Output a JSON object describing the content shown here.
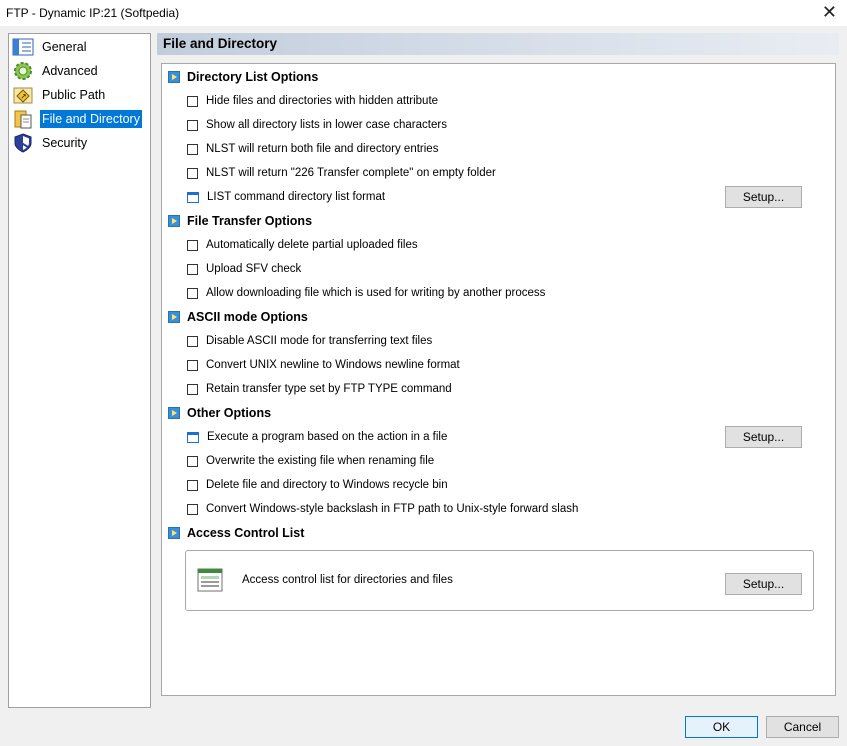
{
  "window": {
    "title": "FTP - Dynamic IP:21 (Softpedia)",
    "close_glyph": "✕"
  },
  "nav": {
    "items": [
      {
        "label": "General",
        "icon": "general-icon",
        "selected": false
      },
      {
        "label": "Advanced",
        "icon": "gear-icon",
        "selected": false
      },
      {
        "label": "Public Path",
        "icon": "public-path-icon",
        "selected": false
      },
      {
        "label": "File and Directory",
        "icon": "file-directory-icon",
        "selected": true
      },
      {
        "label": "Security",
        "icon": "shield-icon",
        "selected": false
      }
    ]
  },
  "page_title": "File and Directory",
  "sections": {
    "directory_list": {
      "title": "Directory List Options",
      "options": [
        "Hide files and directories with hidden attribute",
        "Show all directory lists in lower case characters",
        "NLST will return both file and directory entries",
        "NLST will return \"226 Transfer complete\" on empty folder",
        "LIST command directory list format"
      ]
    },
    "file_transfer": {
      "title": "File Transfer Options",
      "options": [
        "Automatically delete partial uploaded files",
        "Upload SFV check",
        "Allow downloading file which is used for writing by another process"
      ]
    },
    "ascii_mode": {
      "title": "ASCII mode Options",
      "options": [
        "Disable ASCII mode for transferring text files",
        "Convert UNIX newline to Windows newline format",
        "Retain transfer type set by FTP TYPE command"
      ]
    },
    "other": {
      "title": "Other Options",
      "options": [
        "Execute a program based on the action in a file",
        "Overwrite the existing file when renaming file",
        "Delete file and directory to Windows recycle bin",
        "Convert Windows-style backslash in FTP path to Unix-style forward slash"
      ]
    },
    "acl": {
      "title": "Access Control List",
      "description": "Access control list for directories and files"
    }
  },
  "buttons": {
    "setup": "Setup...",
    "ok": "OK",
    "cancel": "Cancel"
  }
}
